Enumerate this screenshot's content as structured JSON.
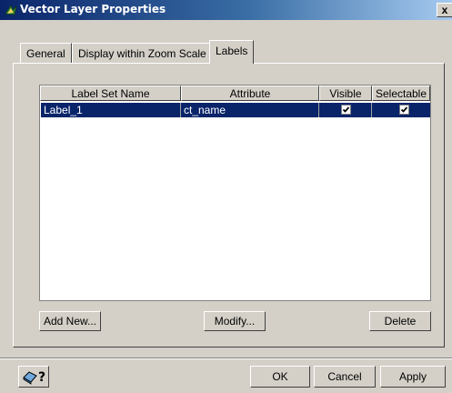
{
  "window": {
    "title": "Vector Layer Properties",
    "close_glyph": "x",
    "title_icon": "layer-icon"
  },
  "tabs": [
    {
      "label": "General",
      "active": false
    },
    {
      "label": "Display within Zoom Scale",
      "active": false
    },
    {
      "label": "Labels",
      "active": true
    }
  ],
  "labels_list": {
    "columns": [
      "Label Set Name",
      "Attribute",
      "Visible",
      "Selectable"
    ],
    "rows": [
      {
        "label_set_name": "Label_1",
        "attribute": "ct_name",
        "visible": true,
        "selectable": true,
        "selected": true
      }
    ]
  },
  "panel_buttons": {
    "add_new": "Add New...",
    "modify": "Modify...",
    "delete": "Delete"
  },
  "footer": {
    "help_icon": "help-pointer-icon",
    "ok": "OK",
    "cancel": "Cancel",
    "apply": "Apply"
  },
  "colors": {
    "title_gradient_start": "#0a246a",
    "title_gradient_end": "#a6caf0",
    "selection": "#0a246a",
    "face": "#d4d0c8"
  }
}
